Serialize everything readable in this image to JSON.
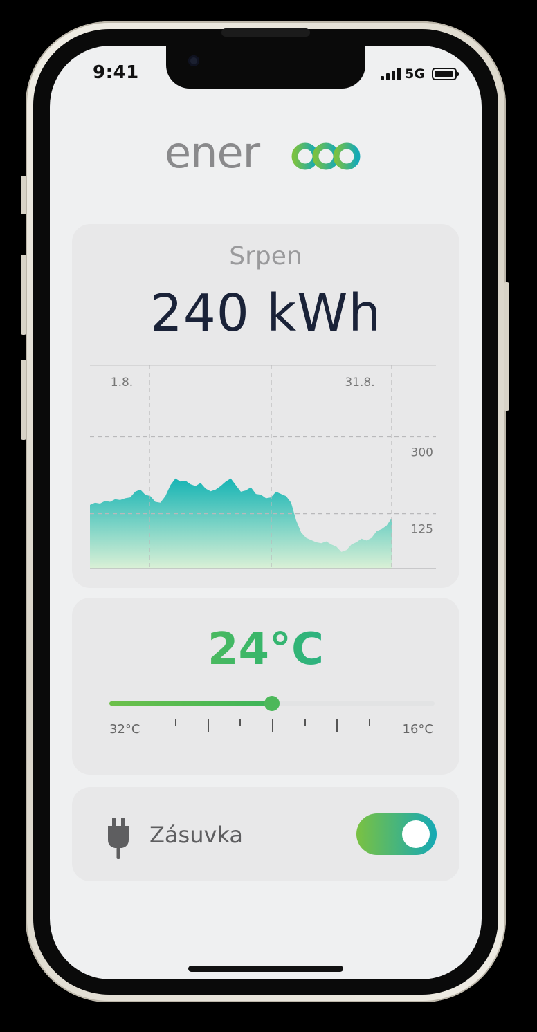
{
  "status_bar": {
    "time": "9:41",
    "network": "5G"
  },
  "logo": {
    "text": "ener",
    "icon": "three-linked-rings-logo-icon",
    "colors": [
      "#8a8a8c",
      "#7ac142",
      "#16a9b5"
    ]
  },
  "energy_card": {
    "month": "Srpen",
    "total": "240 kWh",
    "chart_data": {
      "type": "area",
      "x_labels": [
        "1.8.",
        "31.8."
      ],
      "y_ticks": [
        300,
        125
      ],
      "ylim": [
        0,
        400
      ],
      "grid": true,
      "gradient": [
        "#16b4b4",
        "#daf0d6"
      ],
      "values": [
        145,
        150,
        148,
        154,
        152,
        158,
        156,
        160,
        162,
        175,
        180,
        168,
        165,
        152,
        150,
        165,
        190,
        205,
        198,
        200,
        192,
        188,
        195,
        182,
        176,
        180,
        188,
        198,
        205,
        190,
        175,
        178,
        185,
        170,
        168,
        160,
        162,
        175,
        170,
        165,
        150,
        110,
        82,
        70,
        65,
        60,
        58,
        62,
        55,
        50,
        38,
        42,
        55,
        60,
        68,
        64,
        70,
        85,
        90,
        98,
        115
      ],
      "highlight_segment": [
        "1.8.",
        "31.8."
      ]
    }
  },
  "temperature_card": {
    "value": "24°C",
    "min_label": "32°C",
    "max_label": "16°C",
    "slider_fraction": 0.5
  },
  "socket_card": {
    "icon": "plug-icon",
    "label": "Zásuvka",
    "enabled": true
  }
}
